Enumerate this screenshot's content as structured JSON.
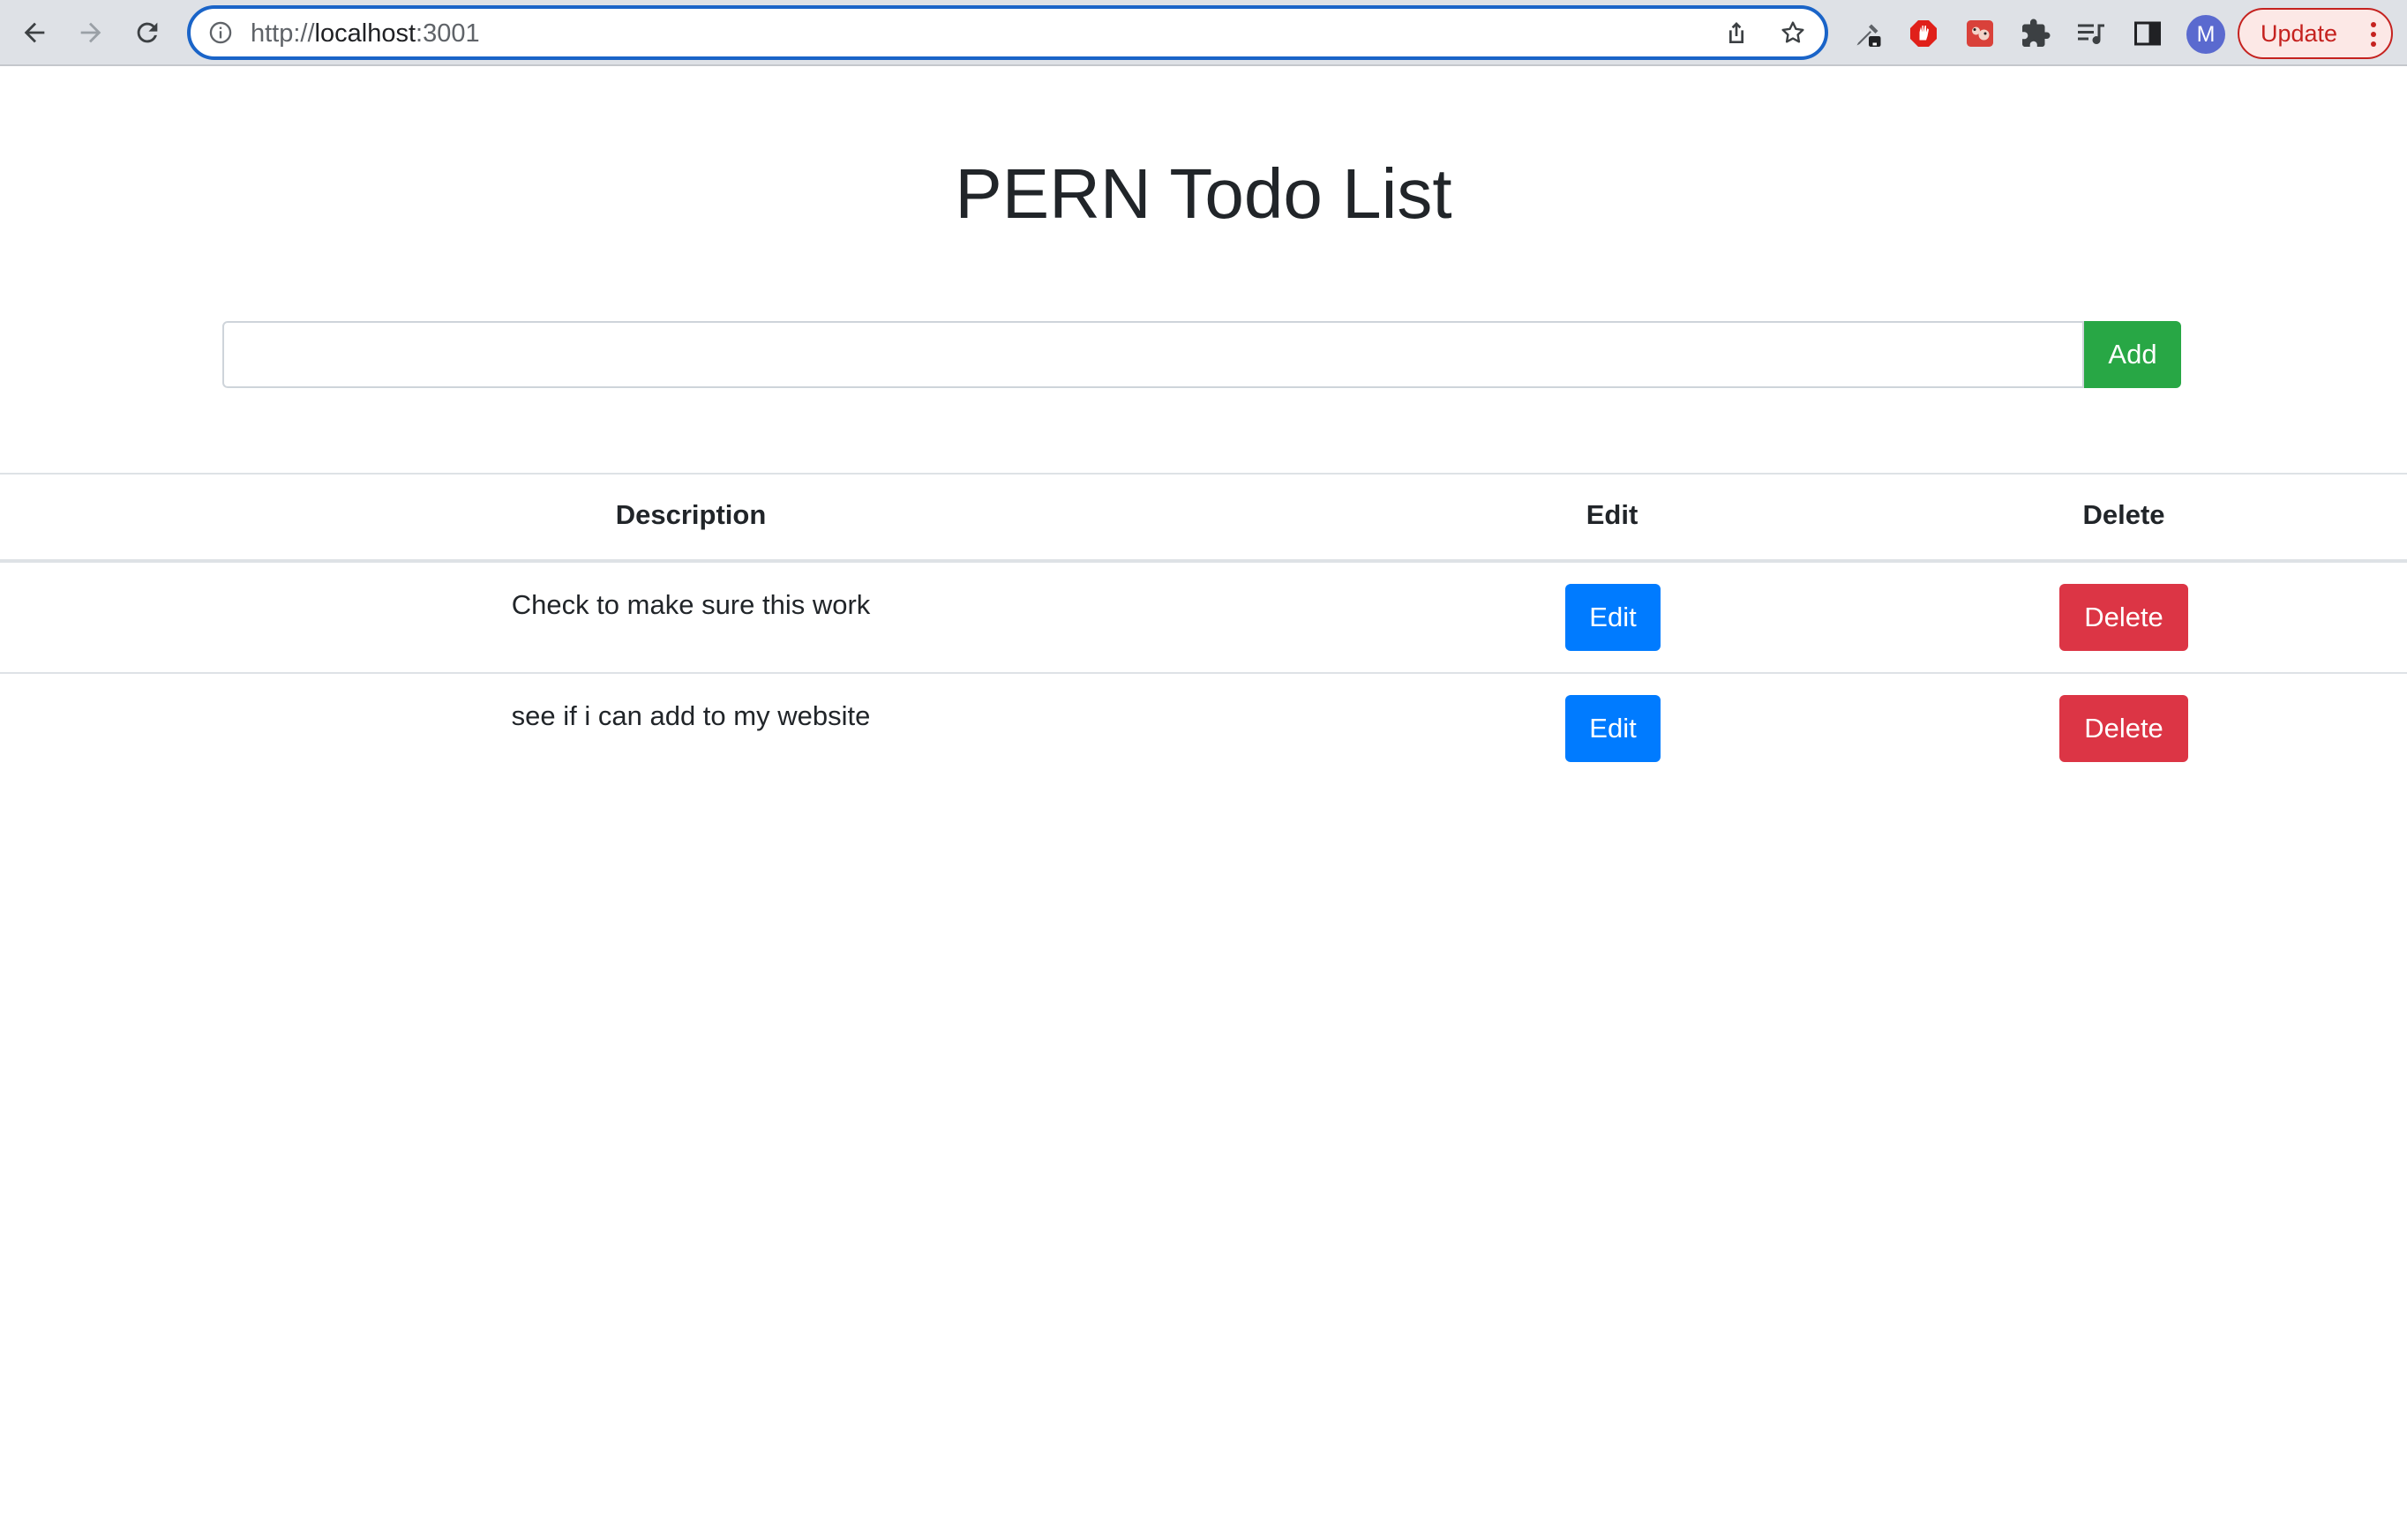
{
  "browser": {
    "url_scheme": "http://",
    "url_host": "localhost",
    "url_port": ":3001",
    "avatar_initial": "M",
    "update_label": "Update",
    "colors": {
      "omnibox_focus": "#1a64c8",
      "update": "#c5221f"
    }
  },
  "page": {
    "title": "PERN Todo List",
    "input": {
      "value": "",
      "placeholder": ""
    },
    "add_label": "Add"
  },
  "table": {
    "headers": {
      "description": "Description",
      "edit": "Edit",
      "delete": "Delete"
    },
    "rows": [
      {
        "description": "Check to make sure this work",
        "edit_label": "Edit",
        "delete_label": "Delete"
      },
      {
        "description": "see if i can add to my website",
        "edit_label": "Edit",
        "delete_label": "Delete"
      }
    ]
  },
  "colors": {
    "add": "#28a745",
    "edit": "#007bff",
    "delete": "#dc3545"
  }
}
